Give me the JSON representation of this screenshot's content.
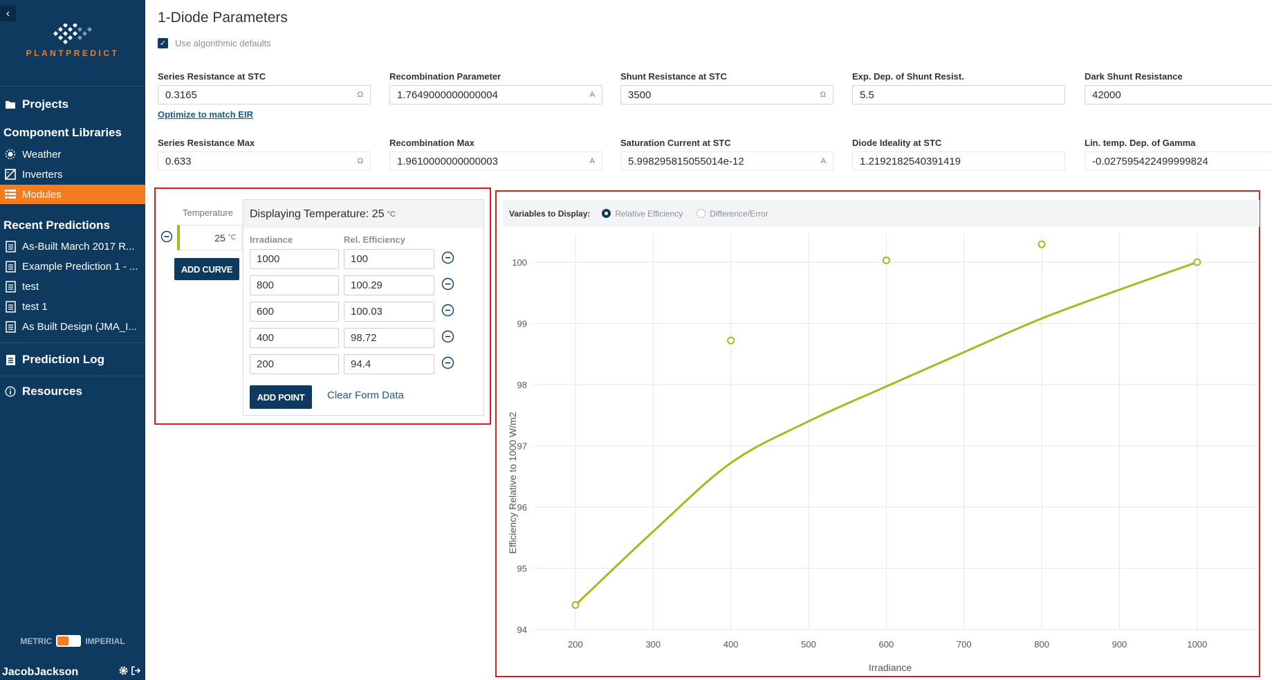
{
  "sidebar": {
    "logo_text": "PLANTPREDICT",
    "projects_label": "Projects",
    "component_libraries_label": "Component Libraries",
    "weather_label": "Weather",
    "inverters_label": "Inverters",
    "modules_label": "Modules",
    "recent_predictions_label": "Recent Predictions",
    "recent_predictions": [
      "As-Built March 2017 R...",
      "Example Prediction 1 - ...",
      "test",
      "test 1",
      "As Built Design (JMA_I..."
    ],
    "prediction_log_label": "Prediction Log",
    "resources_label": "Resources",
    "unit_metric": "METRIC",
    "unit_imperial": "IMPERIAL",
    "username": "JacobJackson",
    "accent_color": "#f47c20",
    "bg_color": "#0e3a5f"
  },
  "page": {
    "title": "1-Diode Parameters",
    "use_defaults_label": "Use algorithmic defaults",
    "use_defaults_checked": true,
    "optimize_link": "Optimize to match EIR"
  },
  "params": [
    {
      "label": "Series Resistance at STC",
      "value": "0.3165",
      "unit": "Ω"
    },
    {
      "label": "Recombination Parameter",
      "value": "1.7649000000000004",
      "unit": "A"
    },
    {
      "label": "Shunt Resistance at STC",
      "value": "3500",
      "unit": "Ω"
    },
    {
      "label": "Exp. Dep. of Shunt Resist.",
      "value": "5.5",
      "unit": ""
    },
    {
      "label": "Dark Shunt Resistance",
      "value": "42000",
      "unit": ""
    },
    {
      "label": "Series Resistance Max",
      "value": "0.633",
      "unit": "Ω"
    },
    {
      "label": "Recombination Max",
      "value": "1.9610000000000003",
      "unit": "A"
    },
    {
      "label": "Saturation Current at STC",
      "value": "5.998295815055014e-12",
      "unit": "A"
    },
    {
      "label": "Diode Ideality at STC",
      "value": "1.2192182540391419",
      "unit": ""
    },
    {
      "label": "Lin. temp. Dep. of Gamma",
      "value": "-0.027595422499999824",
      "unit": ""
    }
  ],
  "curves": {
    "temperature_label": "Temperature",
    "temperature_value": "25",
    "temperature_unit": "°C",
    "add_curve_label": "ADD CURVE",
    "displaying_label": "Displaying Temperature: 25",
    "displaying_unit": "°C",
    "irradiance_header": "Irradiance",
    "efficiency_header": "Rel. Efficiency",
    "rows": [
      {
        "irradiance": "1000",
        "efficiency": "100"
      },
      {
        "irradiance": "800",
        "efficiency": "100.29"
      },
      {
        "irradiance": "600",
        "efficiency": "100.03"
      },
      {
        "irradiance": "400",
        "efficiency": "98.72"
      },
      {
        "irradiance": "200",
        "efficiency": "94.4"
      }
    ],
    "add_point_label": "ADD POINT",
    "clear_label": "Clear Form Data"
  },
  "chart_controls": {
    "variables_label": "Variables to Display:",
    "option_relative": "Relative Efficiency",
    "option_difference": "Difference/Error",
    "selected": "Relative Efficiency"
  },
  "chart_data": {
    "type": "scatter",
    "xlabel": "Irradiance",
    "ylabel": "Efficiency Relative to 1000 W/m2",
    "xlim": [
      160,
      1050
    ],
    "ylim": [
      94,
      100.35
    ],
    "x_ticks": [
      200,
      300,
      400,
      500,
      600,
      700,
      800,
      900,
      1000
    ],
    "y_ticks": [
      94,
      95,
      96,
      97,
      98,
      99,
      100
    ],
    "grid": true,
    "series_color": "#a8b820",
    "points": [
      {
        "x": 200,
        "y": 94.4
      },
      {
        "x": 400,
        "y": 98.72
      },
      {
        "x": 600,
        "y": 100.03
      },
      {
        "x": 800,
        "y": 100.29
      },
      {
        "x": 1000,
        "y": 100
      }
    ],
    "fit_curve": [
      {
        "x": 200,
        "y": 94.4
      },
      {
        "x": 300,
        "y": 95.6
      },
      {
        "x": 400,
        "y": 96.72
      },
      {
        "x": 500,
        "y": 97.4
      },
      {
        "x": 600,
        "y": 97.97
      },
      {
        "x": 700,
        "y": 98.53
      },
      {
        "x": 800,
        "y": 99.08
      },
      {
        "x": 900,
        "y": 99.55
      },
      {
        "x": 1000,
        "y": 100
      }
    ]
  }
}
